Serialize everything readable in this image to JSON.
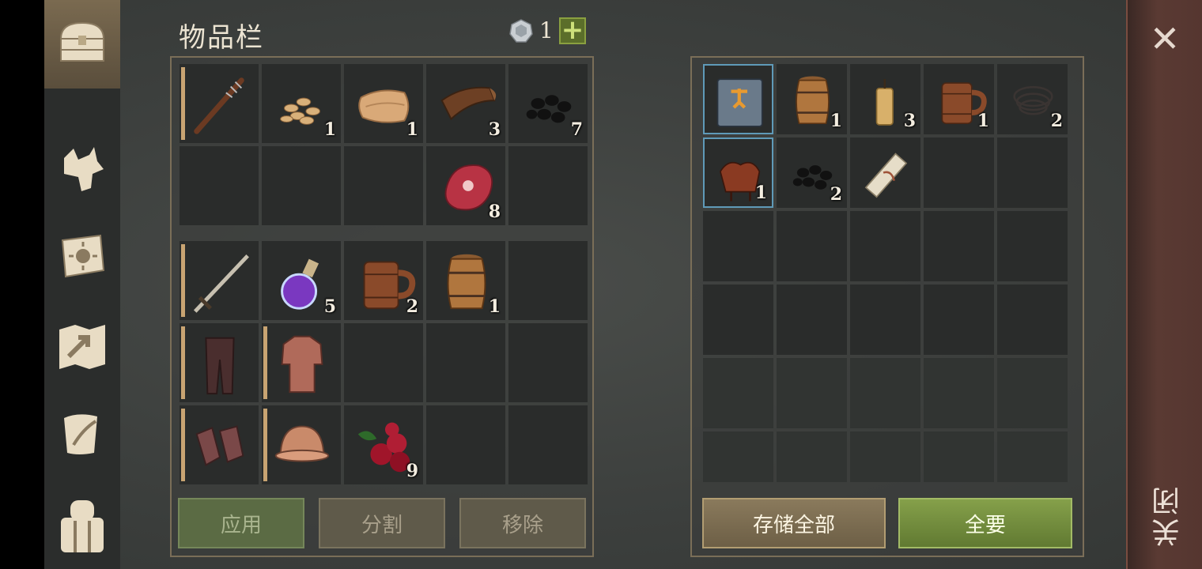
{
  "inventory": {
    "title": "物品栏",
    "coin_count": "1",
    "plus_label": "+",
    "top_grid": [
      {
        "item": "spiked-club",
        "qty": "",
        "equip": true
      },
      {
        "item": "seeds",
        "qty": "1"
      },
      {
        "item": "leather",
        "qty": "1"
      },
      {
        "item": "bark",
        "qty": "3"
      },
      {
        "item": "coal",
        "qty": "7"
      },
      {
        "item": "",
        "qty": ""
      },
      {
        "item": "",
        "qty": ""
      },
      {
        "item": "",
        "qty": ""
      },
      {
        "item": "raw-meat",
        "qty": "8"
      },
      {
        "item": "",
        "qty": ""
      }
    ],
    "bottom_grid": [
      {
        "item": "sword",
        "qty": "",
        "equip": true
      },
      {
        "item": "potion",
        "qty": "5"
      },
      {
        "item": "mug",
        "qty": "2"
      },
      {
        "item": "barrel",
        "qty": "1"
      },
      {
        "item": "",
        "qty": ""
      },
      {
        "item": "chain-pants",
        "qty": "",
        "equip": true
      },
      {
        "item": "chain-armor",
        "qty": "",
        "equip": true
      },
      {
        "item": "",
        "qty": ""
      },
      {
        "item": "",
        "qty": ""
      },
      {
        "item": "",
        "qty": ""
      },
      {
        "item": "chain-gloves",
        "qty": "",
        "equip": true
      },
      {
        "item": "helmet",
        "qty": "",
        "equip": true
      },
      {
        "item": "berries",
        "qty": "9"
      },
      {
        "item": "",
        "qty": ""
      },
      {
        "item": "",
        "qty": ""
      }
    ],
    "buttons": {
      "apply": "应用",
      "split": "分割",
      "remove": "移除"
    }
  },
  "storage": {
    "grid": [
      {
        "item": "recipe-book",
        "qty": "",
        "selected": true
      },
      {
        "item": "barrel",
        "qty": "1"
      },
      {
        "item": "candle",
        "qty": "3"
      },
      {
        "item": "mug",
        "qty": "1"
      },
      {
        "item": "rope",
        "qty": "2"
      },
      {
        "item": "saddle",
        "qty": "1",
        "selected": true
      },
      {
        "item": "coal",
        "qty": "2"
      },
      {
        "item": "paper-roll",
        "qty": ""
      },
      {
        "item": "",
        "qty": ""
      },
      {
        "item": "",
        "qty": ""
      },
      {
        "item": "",
        "qty": ""
      },
      {
        "item": "",
        "qty": ""
      },
      {
        "item": "",
        "qty": ""
      },
      {
        "item": "",
        "qty": ""
      },
      {
        "item": "",
        "qty": ""
      },
      {
        "item": "",
        "qty": ""
      },
      {
        "item": "",
        "qty": ""
      },
      {
        "item": "",
        "qty": ""
      },
      {
        "item": "",
        "qty": ""
      },
      {
        "item": "",
        "qty": ""
      },
      {
        "item": "",
        "qty": "",
        "faded": true
      },
      {
        "item": "",
        "qty": "",
        "faded": true
      },
      {
        "item": "",
        "qty": "",
        "faded": true
      },
      {
        "item": "",
        "qty": "",
        "faded": true
      },
      {
        "item": "",
        "qty": "",
        "faded": true
      },
      {
        "item": "",
        "qty": "",
        "faded": true
      },
      {
        "item": "",
        "qty": "",
        "faded": true
      },
      {
        "item": "",
        "qty": "",
        "faded": true
      },
      {
        "item": "",
        "qty": "",
        "faded": true
      },
      {
        "item": "",
        "qty": "",
        "faded": true
      }
    ],
    "buttons": {
      "store_all": "存储全部",
      "take_all": "全要"
    }
  },
  "close": {
    "label": "关闭"
  },
  "sidebar": {
    "items": [
      "chest-icon",
      "wolf-icon",
      "sun-book-icon",
      "map-icon",
      "scroll-quill-icon",
      "backpack-icon"
    ]
  },
  "colors": {
    "accent_gold": "#c8a472",
    "green_button": "#85a04a",
    "selection_blue": "#5f9ab8"
  }
}
